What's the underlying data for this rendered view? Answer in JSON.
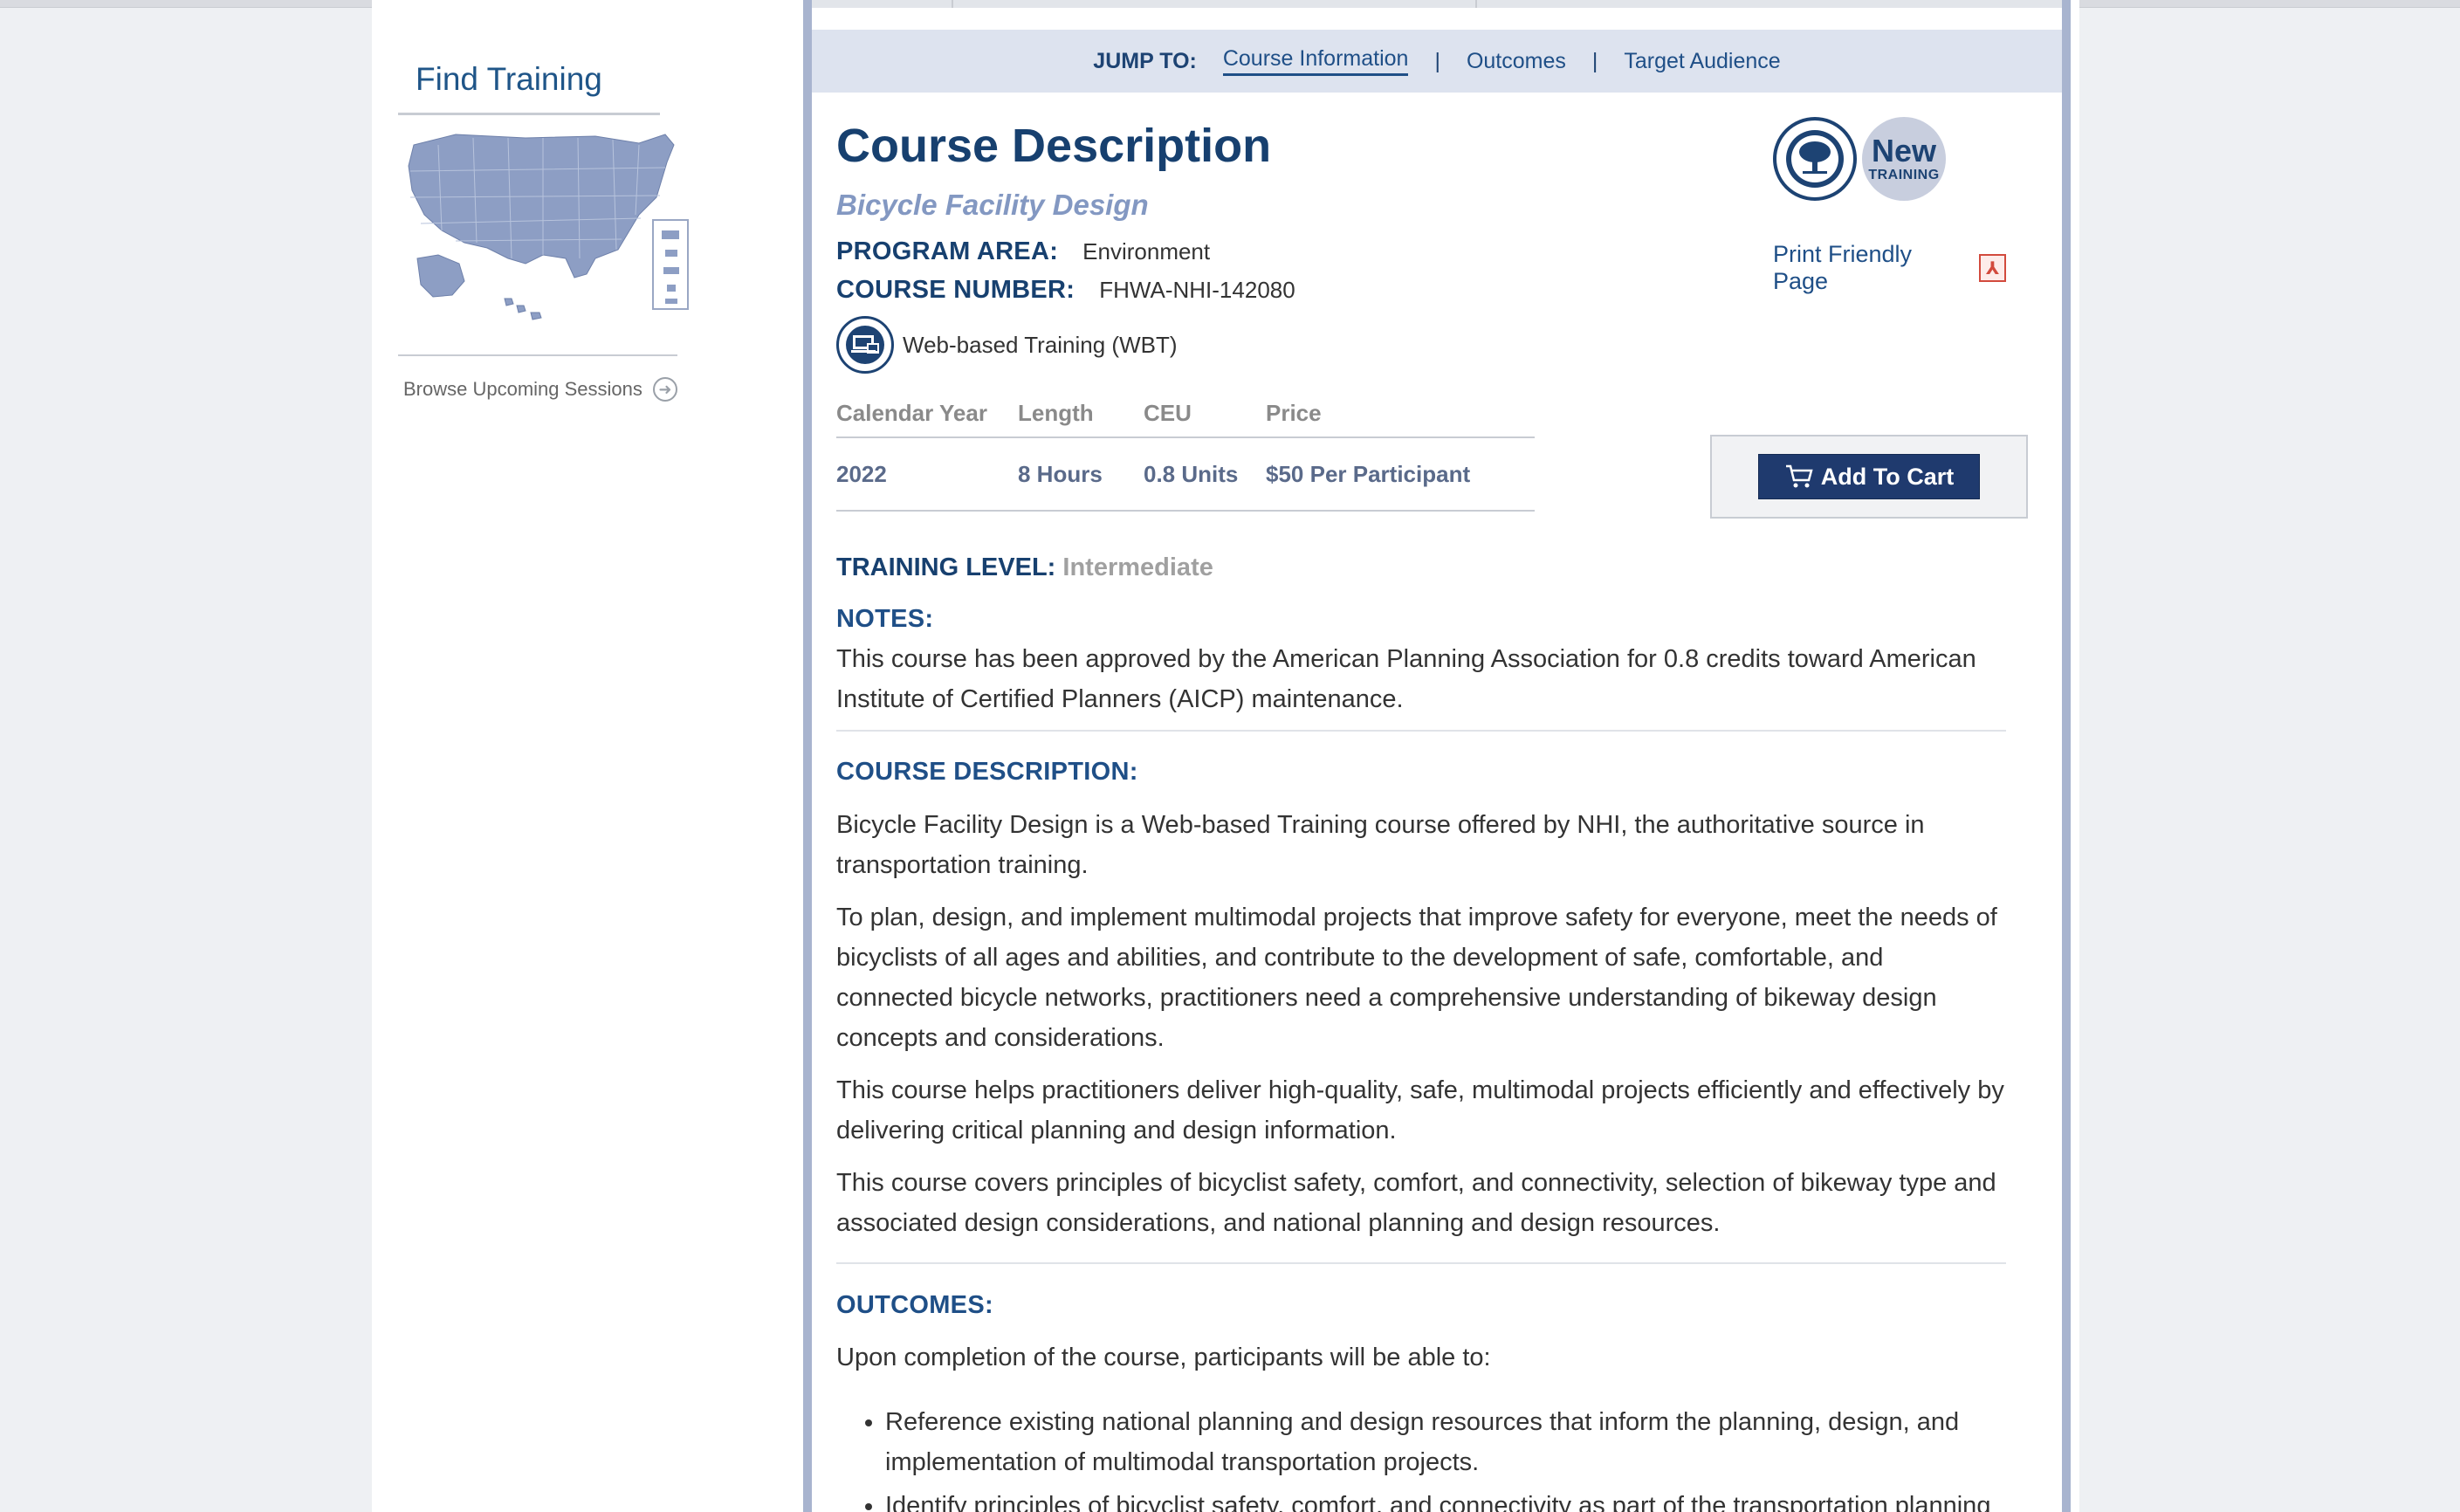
{
  "sidebar": {
    "find_training_title": "Find Training",
    "browse_link": "Browse Upcoming Sessions",
    "map_icon": "us-map-icon",
    "arrow_icon": "arrow-right-circle-icon"
  },
  "jump": {
    "label": "JUMP TO:",
    "links": [
      "Course Information",
      "Outcomes",
      "Target Audience"
    ],
    "separator": "|"
  },
  "course": {
    "title": "Course Description",
    "subtitle": "Bicycle Facility Design",
    "program_area_key": "PROGRAM AREA:",
    "program_area_value": "Environment",
    "course_number_key": "COURSE NUMBER:",
    "course_number_value": "FHWA-NHI-142080",
    "delivery": "Web-based Training (WBT)",
    "new_badge_line1": "New",
    "new_badge_line2": "TRAINING",
    "print_link": "Print Friendly Page"
  },
  "schedule": {
    "headers": [
      "Calendar Year",
      "Length",
      "CEU",
      "Price"
    ],
    "row": [
      "2022",
      "8 Hours",
      "0.8 Units",
      "$50 Per Participant"
    ]
  },
  "cart": {
    "label": "Add To Cart",
    "color": "#1f3a6e"
  },
  "level": {
    "key": "TRAINING LEVEL:",
    "value": "Intermediate"
  },
  "notes": {
    "heading": "NOTES:",
    "text": "This course has been approved by the American Planning Association for 0.8 credits toward American Institute of Certified Planners (AICP) maintenance."
  },
  "description": {
    "heading": "COURSE DESCRIPTION:",
    "paragraphs": [
      "Bicycle Facility Design is a Web-based Training course offered by NHI, the authoritative source in transportation training.",
      "To plan, design, and implement multimodal projects that improve safety for everyone, meet the needs of bicyclists of all ages and abilities, and contribute to the development of safe, comfortable, and connected bicycle networks, practitioners need a comprehensive understanding of bikeway design concepts and considerations.",
      "This course helps practitioners deliver high-quality, safe, multimodal projects efficiently and effectively by delivering critical planning and design information.",
      "This course covers principles of bicyclist safety, comfort, and connectivity, selection of bikeway type and associated design considerations, and national planning and design resources."
    ]
  },
  "outcomes": {
    "heading": "OUTCOMES:",
    "intro": "Upon completion of the course, participants will be able to:",
    "items": [
      "Reference existing national planning and design resources that inform the planning, design, and implementation of multimodal transportation projects.",
      "Identify principles of bicyclist safety, comfort, and connectivity as part of the transportation planning"
    ]
  },
  "colors": {
    "brand_navy": "#17406f",
    "link_blue": "#1f4f87",
    "panel_border": "#a8b4cf",
    "jumpbar_bg": "#dde3ef"
  }
}
